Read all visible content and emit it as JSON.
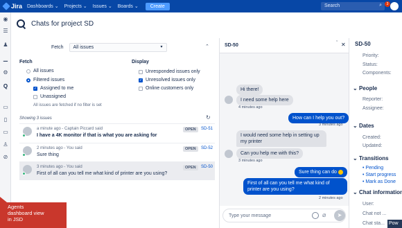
{
  "nav": {
    "brand": "Jira",
    "items": [
      "Dashboards ⌄",
      "Projects ⌄",
      "Issues ⌄",
      "Boards ⌄"
    ],
    "create_label": "Create",
    "search_placeholder": "Search",
    "notifications_count": "3"
  },
  "page": {
    "title": "Chats for project SD"
  },
  "filters": {
    "fetch_label": "Fetch",
    "fetch_value": "All issues",
    "fetch_title": "Fetch",
    "fetch_options": [
      {
        "label": "All issues",
        "selected": false
      },
      {
        "label": "Filtered issues",
        "selected": true
      }
    ],
    "fetch_checks": [
      {
        "label": "Assigned to me",
        "checked": true
      },
      {
        "label": "Unassigned",
        "checked": false
      }
    ],
    "fetch_note": "All issues are fetched if no filter is set",
    "display_title": "Display",
    "display_checks": [
      {
        "label": "Unresponded issues only",
        "checked": false
      },
      {
        "label": "Unresolved issues only",
        "checked": true
      },
      {
        "label": "Online customers only",
        "checked": false
      }
    ]
  },
  "issues": {
    "showing": "Showing 3 issues",
    "rows": [
      {
        "meta": "a minute ago - Captain Piccard said",
        "message": "I have a 4K monitor if that is what you are asking for",
        "status": "OPEN",
        "key": "SD-51",
        "bold": true
      },
      {
        "meta": "2 minutes ago - You said",
        "message": "Sure thing",
        "status": "OPEN",
        "key": "SD-52",
        "bold": false
      },
      {
        "meta": "3 minutes ago - You said",
        "message": "First of all can you tell me what kind of printer are you using?",
        "status": "OPEN",
        "key": "SD-50",
        "bold": false
      }
    ]
  },
  "chat": {
    "key": "SD-50",
    "messages": [
      {
        "from": "customer",
        "text": "Hi there!"
      },
      {
        "from": "customer",
        "text": "I need some help here"
      },
      {
        "time": "4 minutes ago"
      },
      {
        "from": "agent",
        "text": "How can I help you out?"
      },
      {
        "time": "3 minutes ago"
      },
      {
        "from": "customer",
        "text": "I would need some help in setting up"
      },
      {
        "from": "customer",
        "text": "my printer"
      },
      {
        "from": "customer",
        "text": "Can you help me with this?"
      },
      {
        "time": "3 minutes ago"
      },
      {
        "from": "agent",
        "text": "Sure thing can do"
      },
      {
        "from": "agent",
        "text": "First of all can you tell me what kind of"
      },
      {
        "from": "agent",
        "text": "printer are you using?"
      },
      {
        "time": "2 minutes ago"
      }
    ],
    "input_placeholder": "Type your message"
  },
  "details": {
    "key": "SD-50",
    "fields": [
      "Priority:",
      "Status:",
      "Components:"
    ],
    "people_title": "People",
    "people_fields": [
      "Reporter:",
      "Assignee:"
    ],
    "dates_title": "Dates",
    "dates_fields": [
      "Created:",
      "Updated:"
    ],
    "transitions_title": "Transitions",
    "transitions": [
      "Pending",
      "Start progress",
      "Mark as Done"
    ],
    "chat_info_title": "Chat information",
    "chat_info_fields": [
      "User:",
      "Chat not ...",
      "Chat sta..."
    ]
  },
  "overlay": {
    "tip": [
      "Agents",
      "dashboard view",
      "in JSD"
    ],
    "powered": "Pow"
  }
}
